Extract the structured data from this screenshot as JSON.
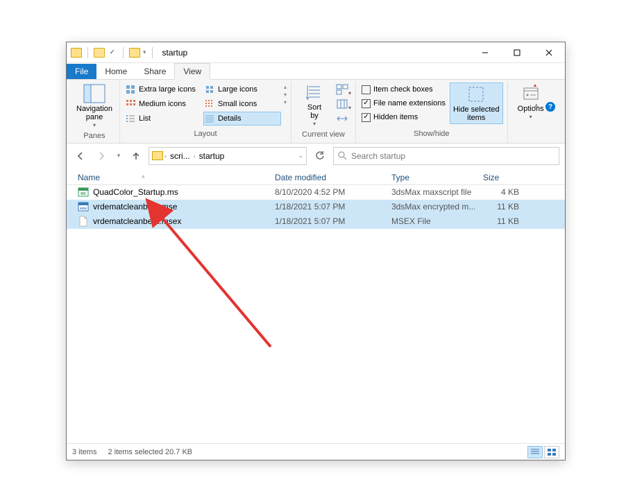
{
  "title": "startup",
  "tabs": {
    "file": "File",
    "home": "Home",
    "share": "Share",
    "view": "View"
  },
  "ribbon": {
    "panes": {
      "label": "Panes",
      "nav": "Navigation\npane"
    },
    "layout": {
      "label": "Layout",
      "opts": [
        "Extra large icons",
        "Large icons",
        "Medium icons",
        "Small icons",
        "List",
        "Details"
      ]
    },
    "current": {
      "label": "Current view",
      "sort": "Sort\nby"
    },
    "showhide": {
      "label": "Show/hide",
      "checks": [
        "Item check boxes",
        "File name extensions",
        "Hidden items"
      ],
      "hide": "Hide selected\nitems"
    },
    "options": "Options"
  },
  "breadcrumb": [
    "scri...",
    "startup"
  ],
  "search_placeholder": "Search startup",
  "columns": {
    "name": "Name",
    "date": "Date modified",
    "type": "Type",
    "size": "Size"
  },
  "files": [
    {
      "name": "QuadColor_Startup.ms",
      "date": "8/10/2020 4:52 PM",
      "type": "3dsMax maxscript file",
      "size": "4 KB",
      "sel": false,
      "ico": "ms"
    },
    {
      "name": "vrdematcleanbeta.mse",
      "date": "1/18/2021 5:07 PM",
      "type": "3dsMax encrypted m...",
      "size": "11 KB",
      "sel": true,
      "ico": "mse"
    },
    {
      "name": "vrdematcleanbeta.msex",
      "date": "1/18/2021 5:07 PM",
      "type": "MSEX File",
      "size": "11 KB",
      "sel": true,
      "ico": "blank"
    }
  ],
  "status": {
    "items": "3 items",
    "selected": "2 items selected  20.7 KB"
  }
}
